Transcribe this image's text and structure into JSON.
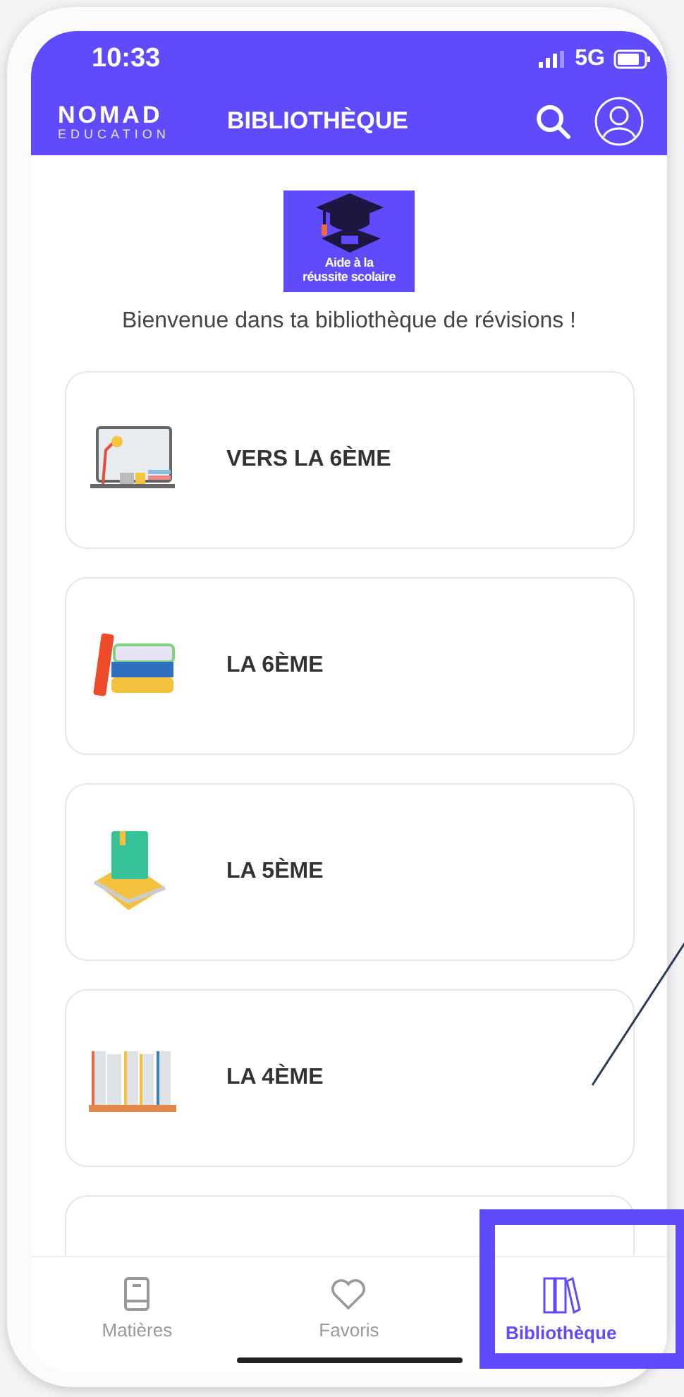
{
  "status_bar": {
    "time": "10:33",
    "network": "5G"
  },
  "header": {
    "logo_name": "NOMAD",
    "logo_tagline": "EDUCATION",
    "title": "BIBLIOTHÈQUE"
  },
  "badge": {
    "lines": [
      "Aide à la",
      "réussite scolaire"
    ]
  },
  "welcome": "Bienvenue dans ta bibliothèque de révisions !",
  "cards": [
    {
      "label": "VERS LA 6ÈME",
      "kind": "desk"
    },
    {
      "label": "LA 6ÈME",
      "kind": "books"
    },
    {
      "label": "LA 5ÈME",
      "kind": "book"
    },
    {
      "label": "LA 4ÈME",
      "kind": "shelf"
    }
  ],
  "tabs": [
    {
      "label": "Matières",
      "kind": "book",
      "selected": false
    },
    {
      "label": "Favoris",
      "kind": "heart",
      "selected": false
    },
    {
      "label": "Bibliothèque",
      "kind": "binders",
      "selected": true
    }
  ]
}
